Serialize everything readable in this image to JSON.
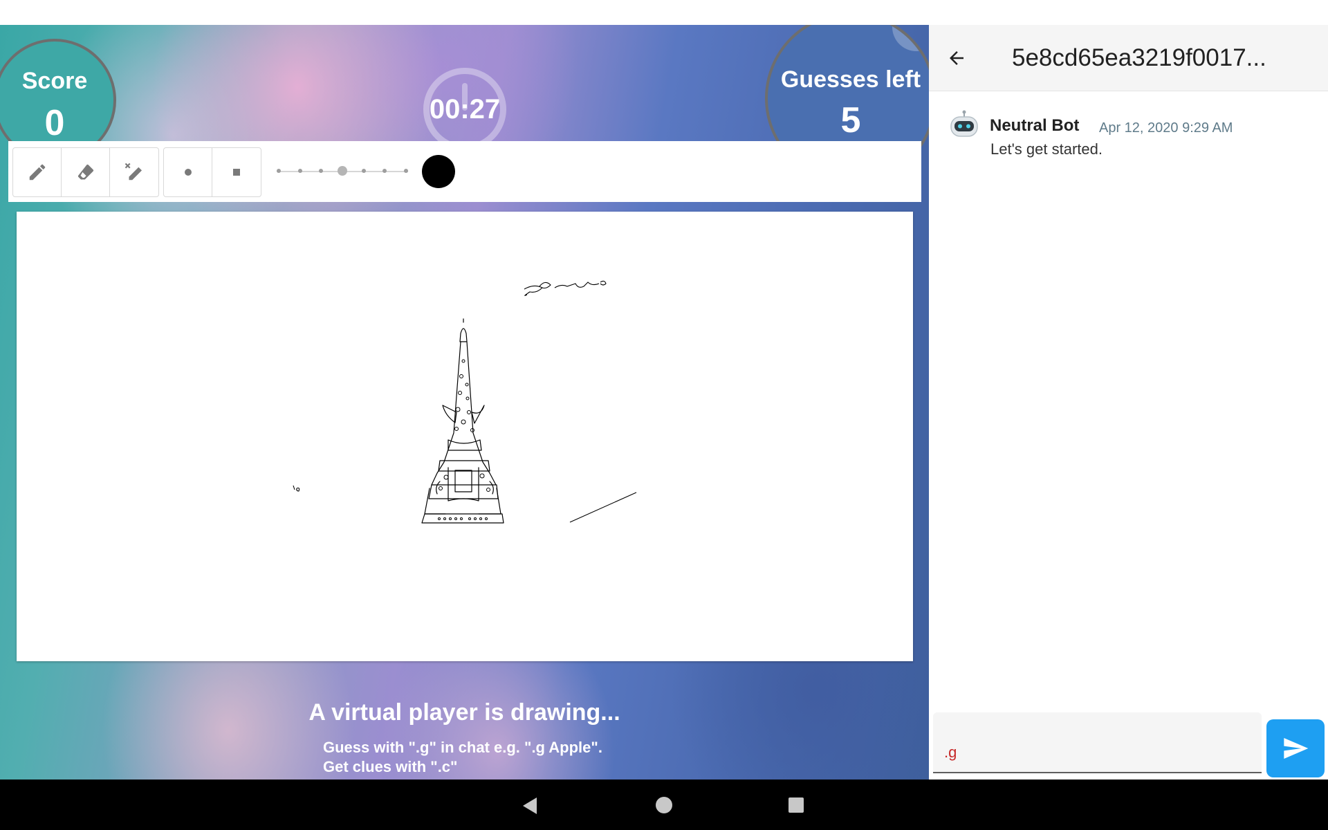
{
  "game": {
    "score_label": "Score",
    "score_value": "0",
    "timer": "00:27",
    "guesses_label": "Guesses left",
    "guesses_value": "5",
    "status_title": "A virtual player is drawing...",
    "instruction_guess": "Guess with \".g\" in chat e.g. \".g Apple\".",
    "instruction_clue": "Get clues with \".c\""
  },
  "toolbar": {
    "tools": [
      "pencil-icon",
      "eraser-icon",
      "stroke-eraser-icon"
    ],
    "tips": [
      "round-tip-icon",
      "square-tip-icon"
    ],
    "stroke_size_steps": 7,
    "stroke_size_selected": 4,
    "color": "#000000"
  },
  "chat": {
    "title": "5e8cd65ea3219f0017...",
    "messages": [
      {
        "author": "Neutral Bot",
        "time": "Apr 12, 2020 9:29 AM",
        "text": "Let's get started."
      }
    ],
    "input_value": ".g",
    "accent_color": "#1e9ff2"
  },
  "navigation": [
    "back",
    "home",
    "recents"
  ]
}
